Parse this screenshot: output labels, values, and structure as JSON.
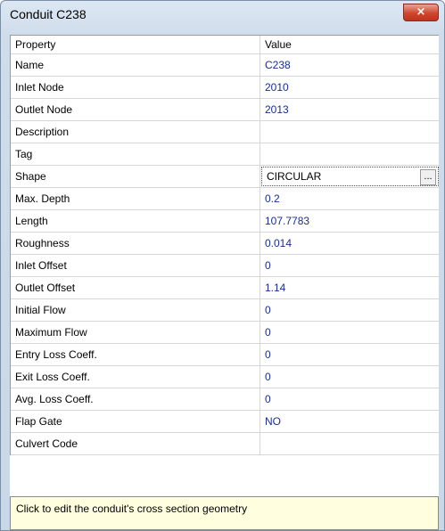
{
  "window": {
    "title": "Conduit C238",
    "close_glyph": "×"
  },
  "grid": {
    "header": {
      "property": "Property",
      "value": "Value"
    },
    "rows": [
      {
        "property": "Name",
        "value": "C238"
      },
      {
        "property": "Inlet Node",
        "value": "2010"
      },
      {
        "property": "Outlet Node",
        "value": "2013"
      },
      {
        "property": "Description",
        "value": ""
      },
      {
        "property": "Tag",
        "value": ""
      },
      {
        "property": "Shape",
        "value": "CIRCULAR",
        "button": "..."
      },
      {
        "property": "Max. Depth",
        "value": "0.2"
      },
      {
        "property": "Length",
        "value": "107.7783"
      },
      {
        "property": "Roughness",
        "value": "0.014"
      },
      {
        "property": "Inlet Offset",
        "value": "0"
      },
      {
        "property": "Outlet Offset",
        "value": "1.14"
      },
      {
        "property": "Initial Flow",
        "value": "0"
      },
      {
        "property": "Maximum Flow",
        "value": "0"
      },
      {
        "property": "Entry Loss Coeff.",
        "value": "0"
      },
      {
        "property": "Exit Loss Coeff.",
        "value": "0"
      },
      {
        "property": "Avg. Loss Coeff.",
        "value": "0"
      },
      {
        "property": "Flap Gate",
        "value": "NO"
      },
      {
        "property": "Culvert Code",
        "value": ""
      }
    ]
  },
  "hint": {
    "text": "Click to edit the conduit's cross section geometry"
  },
  "colors": {
    "value_text": "#1a2d8f",
    "hint_background": "#ffffe0",
    "close_button": "#c0331f"
  }
}
